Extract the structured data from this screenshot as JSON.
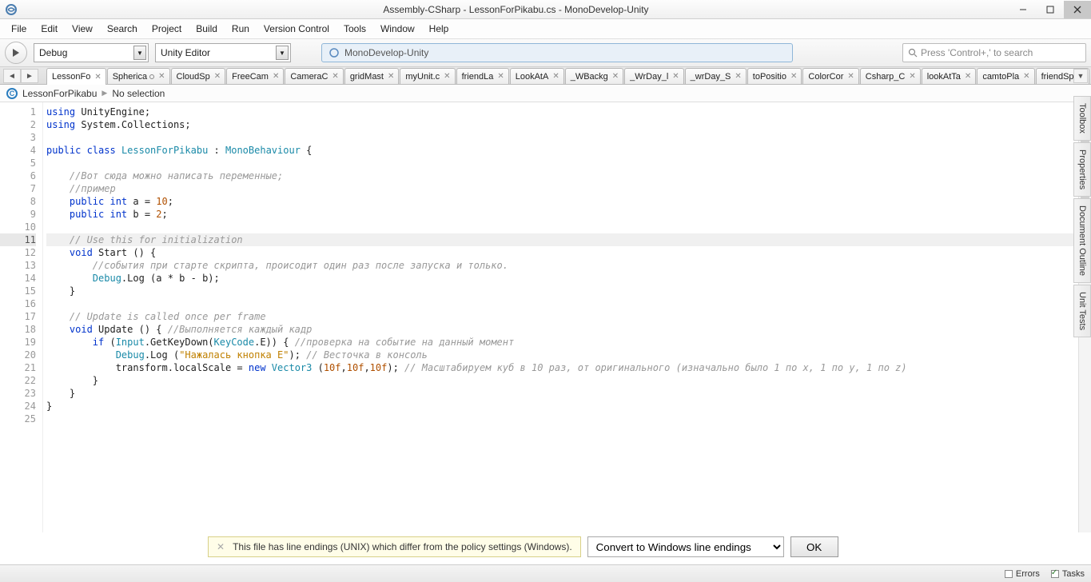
{
  "window": {
    "title": "Assembly-CSharp - LessonForPikabu.cs - MonoDevelop-Unity"
  },
  "menu": [
    "File",
    "Edit",
    "View",
    "Search",
    "Project",
    "Build",
    "Run",
    "Version Control",
    "Tools",
    "Window",
    "Help"
  ],
  "toolbar": {
    "config": "Debug",
    "target": "Unity Editor",
    "process": "MonoDevelop-Unity",
    "search_placeholder": "Press 'Control+,' to search"
  },
  "tabs": [
    "LessonFo",
    "Spherica",
    "CloudSp",
    "FreeCam",
    "CameraC",
    "gridMast",
    "myUnit.c",
    "friendLa",
    "LookAtA",
    "_WBackg",
    "_WrDay_l",
    "_wrDay_S",
    "toPositio",
    "ColorCor",
    "Csharp_C",
    "lookAtTa",
    "camtoPla",
    "friendSp"
  ],
  "activeTab": 0,
  "dirtyTabs": [
    1
  ],
  "breadcrumb": {
    "file": "LessonForPikabu",
    "sel": "No selection"
  },
  "sidepanes": [
    "Toolbox",
    "Properties",
    "Document Outline",
    "Unit Tests"
  ],
  "code": [
    {
      "n": 1,
      "t": [
        [
          "kw",
          "using"
        ],
        [
          "",
          " UnityEngine;"
        ]
      ]
    },
    {
      "n": 2,
      "t": [
        [
          "kw",
          "using"
        ],
        [
          "",
          " System.Collections;"
        ]
      ]
    },
    {
      "n": 3,
      "t": [
        [
          "",
          ""
        ]
      ]
    },
    {
      "n": 4,
      "t": [
        [
          "kw",
          "public class"
        ],
        [
          "",
          " "
        ],
        [
          "ty",
          "LessonForPikabu"
        ],
        [
          "",
          " : "
        ],
        [
          "ty",
          "MonoBehaviour"
        ],
        [
          "",
          " {"
        ]
      ]
    },
    {
      "n": 5,
      "t": [
        [
          "",
          ""
        ]
      ]
    },
    {
      "n": 6,
      "t": [
        [
          "",
          "    "
        ],
        [
          "cm",
          "//Вот сюда можно написать переменные;"
        ]
      ]
    },
    {
      "n": 7,
      "t": [
        [
          "",
          "    "
        ],
        [
          "cm",
          "//пример"
        ]
      ]
    },
    {
      "n": 8,
      "t": [
        [
          "",
          "    "
        ],
        [
          "kw",
          "public int"
        ],
        [
          "",
          " a = "
        ],
        [
          "num",
          "10"
        ],
        [
          "",
          ";"
        ]
      ]
    },
    {
      "n": 9,
      "t": [
        [
          "",
          "    "
        ],
        [
          "kw",
          "public int"
        ],
        [
          "",
          " b = "
        ],
        [
          "num",
          "2"
        ],
        [
          "",
          ";"
        ]
      ]
    },
    {
      "n": 10,
      "t": [
        [
          "",
          ""
        ]
      ]
    },
    {
      "n": 11,
      "hl": true,
      "t": [
        [
          "",
          "    "
        ],
        [
          "cm",
          "// Use this for initialization"
        ]
      ]
    },
    {
      "n": 12,
      "t": [
        [
          "",
          "    "
        ],
        [
          "kw",
          "void"
        ],
        [
          "",
          " Start () {"
        ]
      ]
    },
    {
      "n": 13,
      "t": [
        [
          "",
          "        "
        ],
        [
          "cm",
          "//события при старте скрипта, происодит один раз после запуска и только."
        ]
      ]
    },
    {
      "n": 14,
      "t": [
        [
          "",
          "        "
        ],
        [
          "ty",
          "Debug"
        ],
        [
          "",
          ".Log (a * b - b);"
        ]
      ]
    },
    {
      "n": 15,
      "t": [
        [
          "",
          "    }"
        ]
      ]
    },
    {
      "n": 16,
      "t": [
        [
          "",
          ""
        ]
      ]
    },
    {
      "n": 17,
      "t": [
        [
          "",
          "    "
        ],
        [
          "cm",
          "// Update is called once per frame"
        ]
      ]
    },
    {
      "n": 18,
      "t": [
        [
          "",
          "    "
        ],
        [
          "kw",
          "void"
        ],
        [
          "",
          " Update () { "
        ],
        [
          "cm",
          "//Выполняется каждый кадр"
        ]
      ]
    },
    {
      "n": 19,
      "t": [
        [
          "",
          "        "
        ],
        [
          "kw",
          "if"
        ],
        [
          "",
          " ("
        ],
        [
          "ty",
          "Input"
        ],
        [
          "",
          ".GetKeyDown("
        ],
        [
          "ty",
          "KeyCode"
        ],
        [
          "",
          ".E)) { "
        ],
        [
          "cm",
          "//проверка на событие на данный момент"
        ]
      ]
    },
    {
      "n": 20,
      "t": [
        [
          "",
          "            "
        ],
        [
          "ty",
          "Debug"
        ],
        [
          "",
          ".Log ("
        ],
        [
          "str",
          "\"Нажалась кнопка E\""
        ],
        [
          "",
          "); "
        ],
        [
          "cm",
          "// Весточка в консоль"
        ]
      ]
    },
    {
      "n": 21,
      "t": [
        [
          "",
          "            transform.localScale = "
        ],
        [
          "kw",
          "new"
        ],
        [
          "",
          " "
        ],
        [
          "ty",
          "Vector3"
        ],
        [
          "",
          " ("
        ],
        [
          "num",
          "10f"
        ],
        [
          "",
          ","
        ],
        [
          "num",
          "10f"
        ],
        [
          "",
          ","
        ],
        [
          "num",
          "10f"
        ],
        [
          "",
          "); "
        ],
        [
          "cm",
          "// Масштабируем куб в 10 раз, от оригинального (изначально было 1 по x, 1 по y, 1 по z)"
        ]
      ]
    },
    {
      "n": 22,
      "t": [
        [
          "",
          "        }"
        ]
      ]
    },
    {
      "n": 23,
      "t": [
        [
          "",
          "    }"
        ]
      ]
    },
    {
      "n": 24,
      "t": [
        [
          "",
          "}"
        ]
      ]
    },
    {
      "n": 25,
      "t": [
        [
          "",
          ""
        ]
      ]
    }
  ],
  "notification": {
    "message": "This file has line endings (UNIX) which differ from the policy settings (Windows).",
    "action": "Convert to Windows line endings",
    "ok": "OK"
  },
  "status": {
    "errors": "Errors",
    "tasks": "Tasks"
  }
}
